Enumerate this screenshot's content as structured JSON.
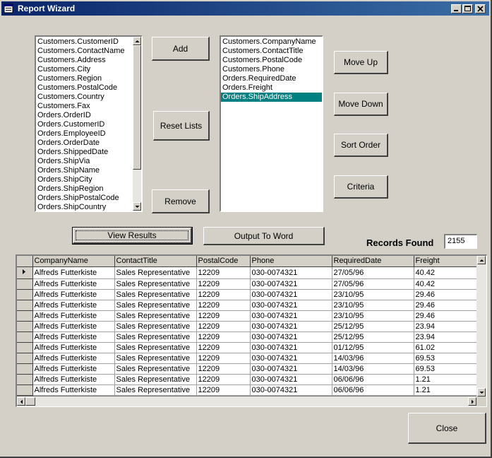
{
  "window": {
    "title": "Report Wizard"
  },
  "available_fields": [
    "Customers.CustomerID",
    "Customers.ContactName",
    "Customers.Address",
    "Customers.City",
    "Customers.Region",
    "Customers.PostalCode",
    "Customers.Country",
    "Customers.Fax",
    "Orders.OrderID",
    "Orders.CustomerID",
    "Orders.EmployeeID",
    "Orders.OrderDate",
    "Orders.ShippedDate",
    "Orders.ShipVia",
    "Orders.ShipName",
    "Orders.ShipCity",
    "Orders.ShipRegion",
    "Orders.ShipPostalCode",
    "Orders.ShipCountry"
  ],
  "selected_fields": [
    "Customers.CompanyName",
    "Customers.ContactTitle",
    "Customers.PostalCode",
    "Customers.Phone",
    "Orders.RequiredDate",
    "Orders.Freight",
    "Orders.ShipAddress"
  ],
  "selected_index": 6,
  "buttons": {
    "add": "Add",
    "reset_lists": "Reset Lists",
    "remove": "Remove",
    "move_up": "Move Up",
    "move_down": "Move Down",
    "sort_order": "Sort Order",
    "criteria": "Criteria",
    "view_results": "View Results",
    "output_to_word": "Output To Word",
    "close": "Close"
  },
  "records_found": {
    "label": "Records Found",
    "value": "2155"
  },
  "results": {
    "columns": [
      "CompanyName",
      "ContactTitle",
      "PostalCode",
      "Phone",
      "RequiredDate",
      "Freight"
    ],
    "rows": [
      [
        "Alfreds Futterkiste",
        "Sales Representative",
        "12209",
        "030-0074321",
        "27/05/96",
        "40.42"
      ],
      [
        "Alfreds Futterkiste",
        "Sales Representative",
        "12209",
        "030-0074321",
        "27/05/96",
        "40.42"
      ],
      [
        "Alfreds Futterkiste",
        "Sales Representative",
        "12209",
        "030-0074321",
        "23/10/95",
        "29.46"
      ],
      [
        "Alfreds Futterkiste",
        "Sales Representative",
        "12209",
        "030-0074321",
        "23/10/95",
        "29.46"
      ],
      [
        "Alfreds Futterkiste",
        "Sales Representative",
        "12209",
        "030-0074321",
        "23/10/95",
        "29.46"
      ],
      [
        "Alfreds Futterkiste",
        "Sales Representative",
        "12209",
        "030-0074321",
        "25/12/95",
        "23.94"
      ],
      [
        "Alfreds Futterkiste",
        "Sales Representative",
        "12209",
        "030-0074321",
        "25/12/95",
        "23.94"
      ],
      [
        "Alfreds Futterkiste",
        "Sales Representative",
        "12209",
        "030-0074321",
        "01/12/95",
        "61.02"
      ],
      [
        "Alfreds Futterkiste",
        "Sales Representative",
        "12209",
        "030-0074321",
        "14/03/96",
        "69.53"
      ],
      [
        "Alfreds Futterkiste",
        "Sales Representative",
        "12209",
        "030-0074321",
        "14/03/96",
        "69.53"
      ],
      [
        "Alfreds Futterkiste",
        "Sales Representative",
        "12209",
        "030-0074321",
        "06/06/96",
        "1.21"
      ],
      [
        "Alfreds Futterkiste",
        "Sales Representative",
        "12209",
        "030-0074321",
        "06/06/96",
        "1.21"
      ]
    ],
    "current_row": 0
  }
}
